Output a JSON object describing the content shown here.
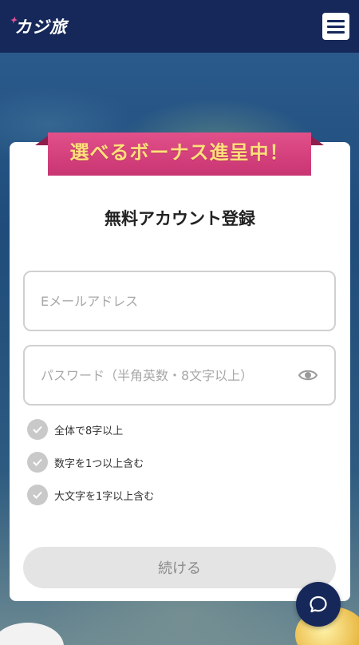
{
  "header": {
    "logo_text": "カジ旅",
    "logo_spark": "✦"
  },
  "banner": {
    "text": "選べるボーナス進呈中！"
  },
  "form": {
    "title": "無料アカウント登録",
    "email_placeholder": "Eメールアドレス",
    "password_placeholder": "パスワード（半角英数・8文字以上）",
    "rules": [
      {
        "label": "全体で8字以上"
      },
      {
        "label": "数字を1つ以上含む"
      },
      {
        "label": "大文字を1字以上含む"
      }
    ],
    "continue_label": "続ける"
  },
  "colors": {
    "header_bg": "#16285a",
    "ribbon": "#d6427d",
    "ribbon_text": "#ffe07a",
    "check_bg": "#c9c9c9",
    "button_bg": "#e4e4e4"
  },
  "icons": {
    "menu": "hamburger-icon",
    "eye": "eye-icon",
    "check": "check-icon",
    "chat": "chat-icon"
  }
}
